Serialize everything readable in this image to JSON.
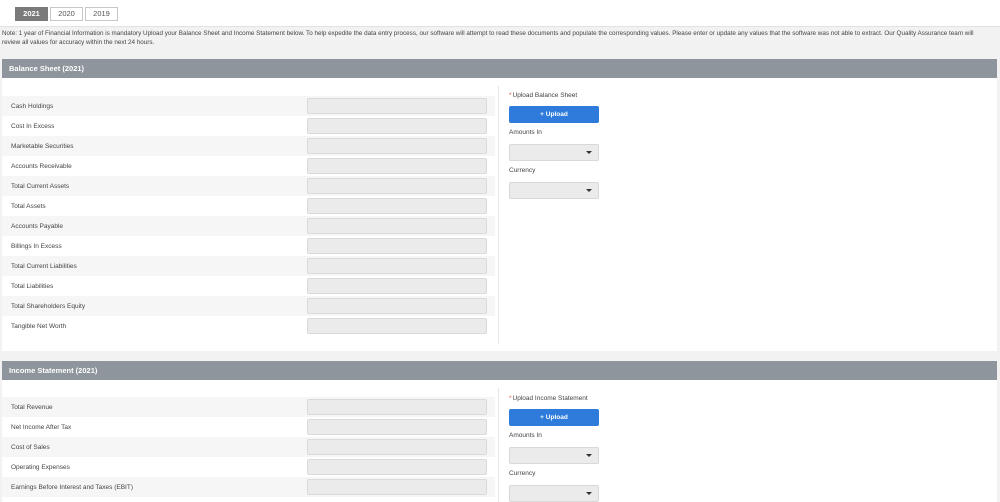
{
  "tabs": [
    {
      "label": "2021",
      "active": true
    },
    {
      "label": "2020",
      "active": false
    },
    {
      "label": "2019",
      "active": false
    }
  ],
  "note": "Note: 1 year of Financial Information is mandatory Upload your Balance Sheet and Income Statement below. To help expedite the data entry process, our software will attempt to read these documents and populate the corresponding values. Please enter or update any values that the software was not able to extract. Our Quality Assurance team will review all values for accuracy within the next 24 hours.",
  "balance_sheet": {
    "title": "Balance Sheet (2021)",
    "fields": [
      {
        "label": "Cash Holdings",
        "value": ""
      },
      {
        "label": "Cost In Excess",
        "value": ""
      },
      {
        "label": "Marketable Securities",
        "value": ""
      },
      {
        "label": "Accounts Receivable",
        "value": ""
      },
      {
        "label": "Total Current Assets",
        "value": ""
      },
      {
        "label": "Total Assets",
        "value": ""
      },
      {
        "label": "Accounts Payable",
        "value": ""
      },
      {
        "label": "Billings In Excess",
        "value": ""
      },
      {
        "label": "Total Current Liabilities",
        "value": ""
      },
      {
        "label": "Total Liabilities",
        "value": ""
      },
      {
        "label": "Total Shareholders Equity",
        "value": ""
      },
      {
        "label": "Tangible Net Worth",
        "value": ""
      }
    ],
    "upload": {
      "required_mark": "*",
      "title": "Upload Balance Sheet",
      "button_label": "+ Upload",
      "amounts_label": "Amounts In",
      "amounts_value": "",
      "currency_label": "Currency",
      "currency_value": ""
    }
  },
  "income_statement": {
    "title": "Income Statement (2021)",
    "fields": [
      {
        "label": "Total Revenue",
        "value": ""
      },
      {
        "label": "Net Income After Tax",
        "value": ""
      },
      {
        "label": "Cost of Sales",
        "value": ""
      },
      {
        "label": "Operating Expenses",
        "value": ""
      },
      {
        "label": "Earnings Before Interest and Taxes (EBIT)",
        "value": ""
      }
    ],
    "upload": {
      "required_mark": "*",
      "title": "Upload Income Statement",
      "button_label": "+ Upload",
      "amounts_label": "Amounts In",
      "amounts_value": "",
      "currency_label": "Currency",
      "currency_value": ""
    }
  }
}
